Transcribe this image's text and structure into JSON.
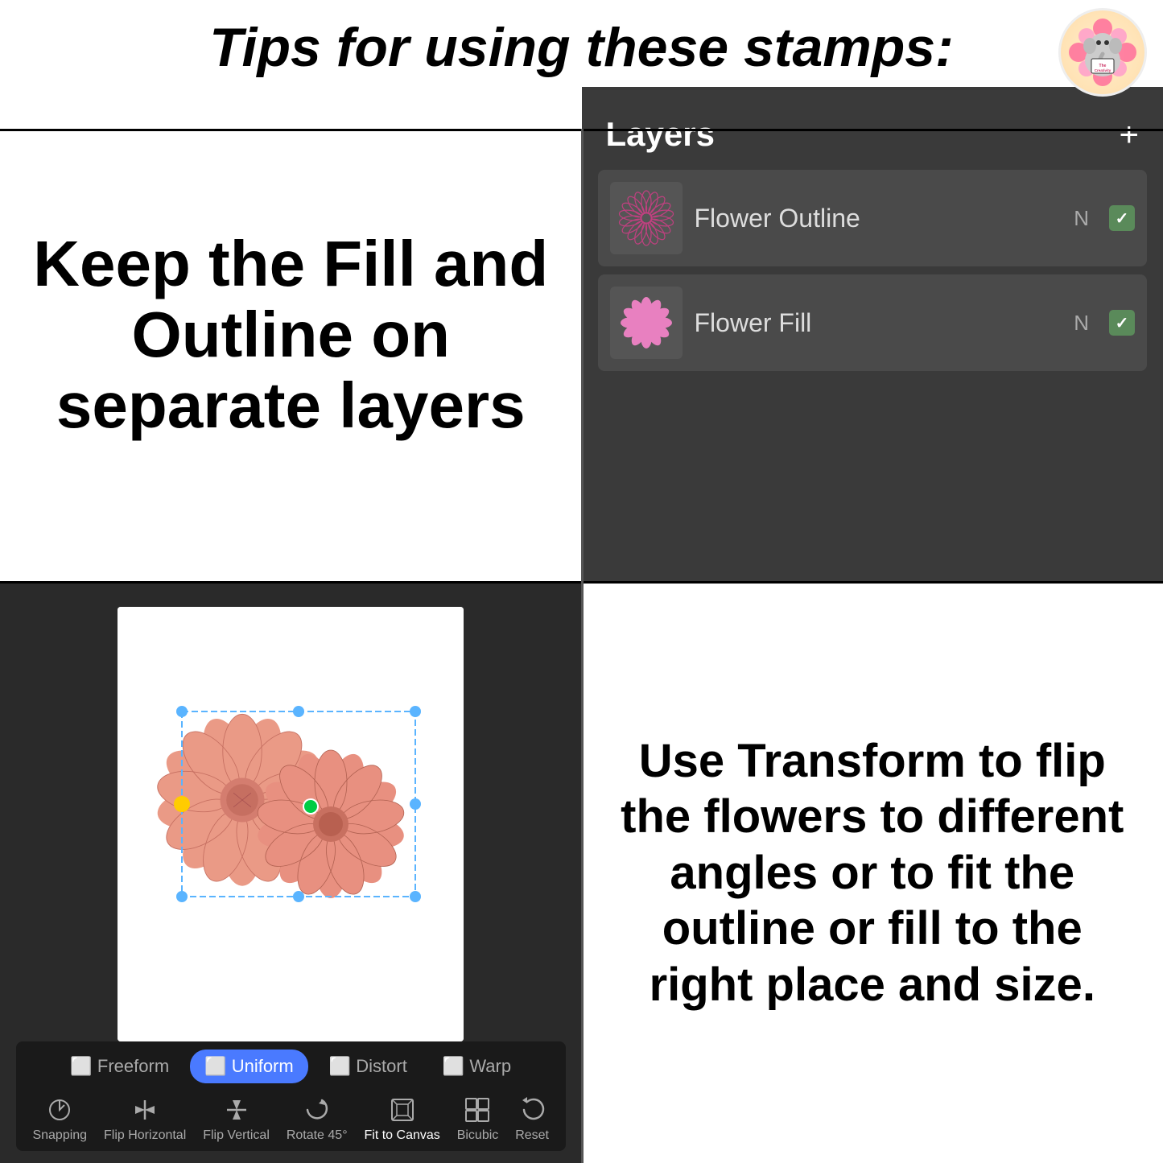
{
  "header": {
    "title": "Tips for using these stamps:"
  },
  "logo": {
    "line1": "The",
    "line2": "Creativity",
    "line3": "City"
  },
  "top_left": {
    "text": "Keep the Fill and Outline on separate layers"
  },
  "layers_panel": {
    "title": "Layers",
    "add_button": "+",
    "layers": [
      {
        "name": "Flower Outline",
        "mode": "N",
        "visible": true,
        "type": "outline"
      },
      {
        "name": "Flower Fill",
        "mode": "N",
        "visible": true,
        "type": "fill"
      }
    ]
  },
  "toolbar": {
    "tabs": [
      {
        "label": "Freeform",
        "active": false
      },
      {
        "label": "Uniform",
        "active": true
      },
      {
        "label": "Distort",
        "active": false
      },
      {
        "label": "Warp",
        "active": false
      }
    ],
    "tools": [
      {
        "label": "Snapping",
        "icon": "⟳"
      },
      {
        "label": "Flip Horizontal",
        "icon": "↔"
      },
      {
        "label": "Flip Vertical",
        "icon": "↕"
      },
      {
        "label": "Rotate 45°",
        "icon": "↻"
      },
      {
        "label": "Fit to Canvas",
        "icon": "⊡"
      },
      {
        "label": "Bicubic",
        "icon": "⊞"
      },
      {
        "label": "Reset",
        "icon": "↺"
      }
    ]
  },
  "bottom_right": {
    "text": "Use Transform to flip the flowers to different angles or to fit the outline or fill to the right place and size."
  }
}
